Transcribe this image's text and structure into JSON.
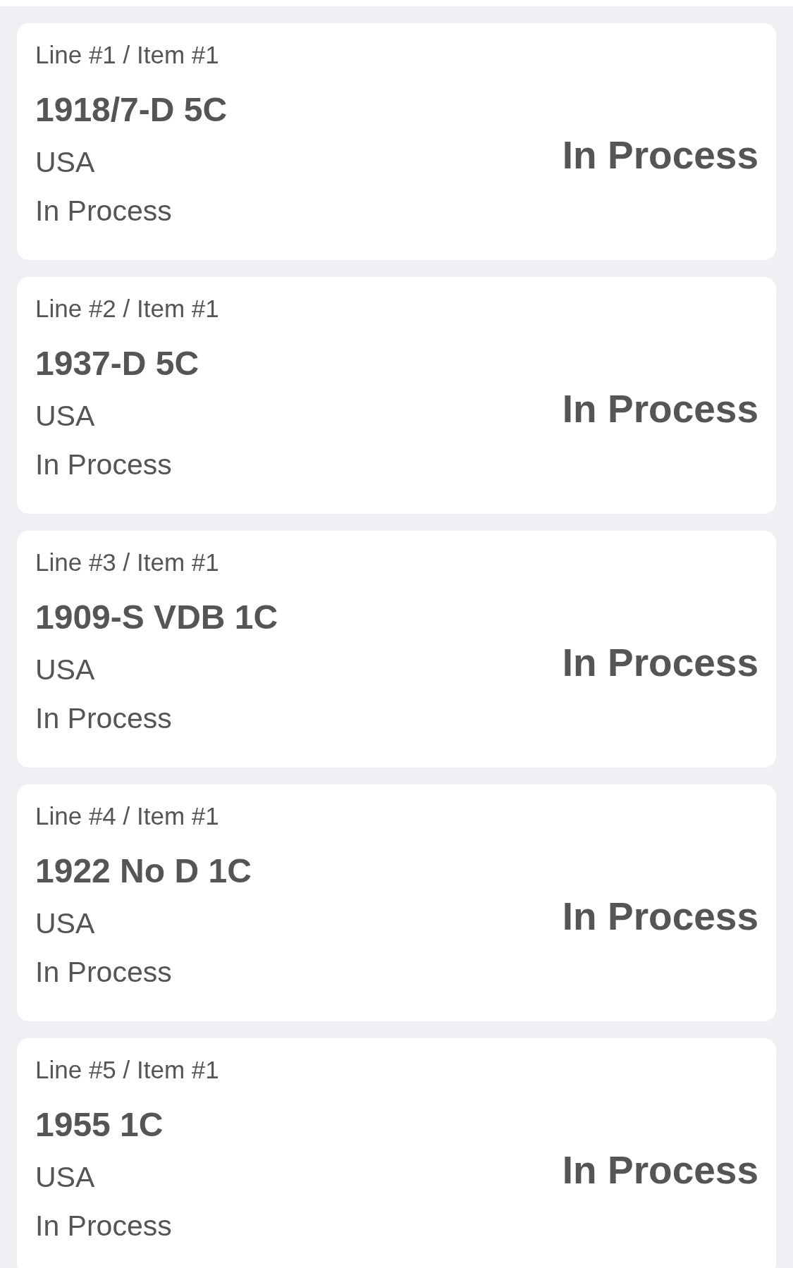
{
  "orders": [
    {
      "line_label": "Line #1 / Item #1",
      "title": "1918/7-D 5C",
      "country": "USA",
      "status": "In Process",
      "status_summary": "In Process"
    },
    {
      "line_label": "Line #2 / Item #1",
      "title": "1937-D 5C",
      "country": "USA",
      "status": "In Process",
      "status_summary": "In Process"
    },
    {
      "line_label": "Line #3 / Item #1",
      "title": "1909-S VDB 1C",
      "country": "USA",
      "status": "In Process",
      "status_summary": "In Process"
    },
    {
      "line_label": "Line #4 / Item #1",
      "title": "1922 No D 1C",
      "country": "USA",
      "status": "In Process",
      "status_summary": "In Process"
    },
    {
      "line_label": "Line #5 / Item #1",
      "title": "1955 1C",
      "country": "USA",
      "status": "In Process",
      "status_summary": "In Process"
    }
  ]
}
